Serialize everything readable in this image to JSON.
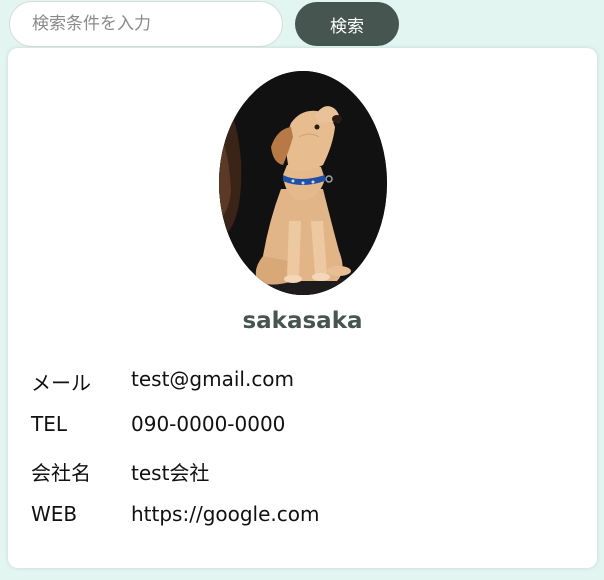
{
  "search": {
    "placeholder": "検索条件を入力",
    "button_label": "検索"
  },
  "profile": {
    "name": "sakasaka",
    "avatar_icon": "dog-photo",
    "rows": [
      {
        "label": "メール",
        "value": "test@gmail.com"
      },
      {
        "label": "TEL",
        "value": "090-0000-0000"
      },
      {
        "label": "会社名",
        "value": "test会社"
      },
      {
        "label": "WEB",
        "value": "https://google.com"
      }
    ]
  },
  "colors": {
    "page_background": "#e2f5f1",
    "accent": "#46554f",
    "card_background": "#ffffff"
  }
}
